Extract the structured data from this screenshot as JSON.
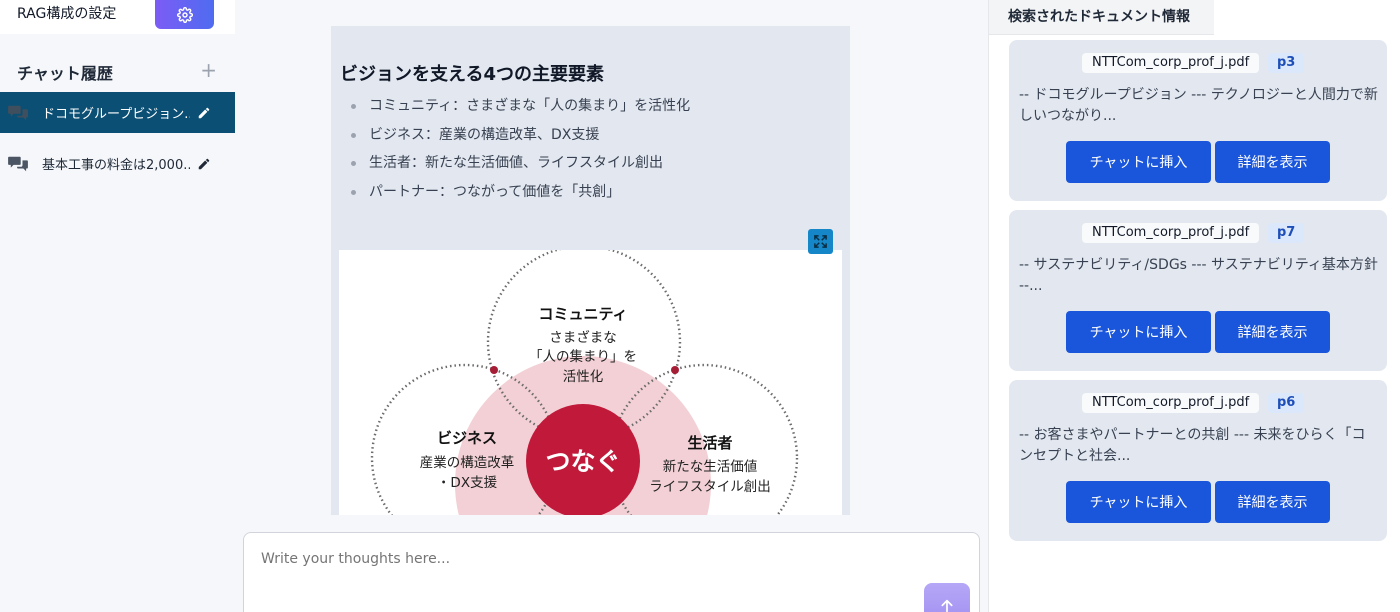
{
  "sidebar": {
    "rag_config_label": "RAG構成の設定",
    "history_title": "チャット履歴",
    "add_symbol": "+",
    "items": [
      {
        "label": "ドコモグループビジョン..."
      },
      {
        "label": "基本工事の料金は2,000..."
      }
    ]
  },
  "main": {
    "heading": "ビジョンを支える4つの主要要素",
    "bullets": [
      "コミュニティ：さまざまな「人の集まり」を活性化",
      "ビジネス：産業の構造改革、DX支援",
      "生活者：新たな生活価値、ライフスタイル創出",
      "パートナー：つながって価値を「共創」"
    ],
    "diagram": {
      "center": "つなぐ",
      "community_title": "コミュニティ",
      "community_line1": "さまざまな",
      "community_line2": "「人の集まり」を",
      "community_line3": "活性化",
      "business_title": "ビジネス",
      "business_line1": "産業の構造改革",
      "business_line2": "・DX支援",
      "consumer_title": "生活者",
      "consumer_line1": "新たな生活価値",
      "consumer_line2": "ライフスタイル創出"
    }
  },
  "input": {
    "placeholder": "Write your thoughts here..."
  },
  "right_panel": {
    "tab_label": "検索されたドキュメント情報",
    "documents": [
      {
        "filename": "NTTCom_corp_prof_j.pdf",
        "page": "p3",
        "snippet": "-- ドコモグループビジョン --- テクノロジーと人間力で新しいつながり...",
        "insert_label": "チャットに挿入",
        "detail_label": "詳細を表示"
      },
      {
        "filename": "NTTCom_corp_prof_j.pdf",
        "page": "p7",
        "snippet": "-- サステナビリティ/SDGs --- サステナビリティ基本方針 --...",
        "insert_label": "チャットに挿入",
        "detail_label": "詳細を表示"
      },
      {
        "filename": "NTTCom_corp_prof_j.pdf",
        "page": "p6",
        "snippet": "-- お客さまやパートナーとの共創 --- 未来をひらく「コンセプトと社会...",
        "insert_label": "チャットに挿入",
        "detail_label": "詳細を表示"
      }
    ]
  },
  "colors": {
    "accent": "#1a56db",
    "active_history": "#0b4f74",
    "diagram_center": "#c0193a",
    "diagram_fill": "#f2d0d5"
  }
}
